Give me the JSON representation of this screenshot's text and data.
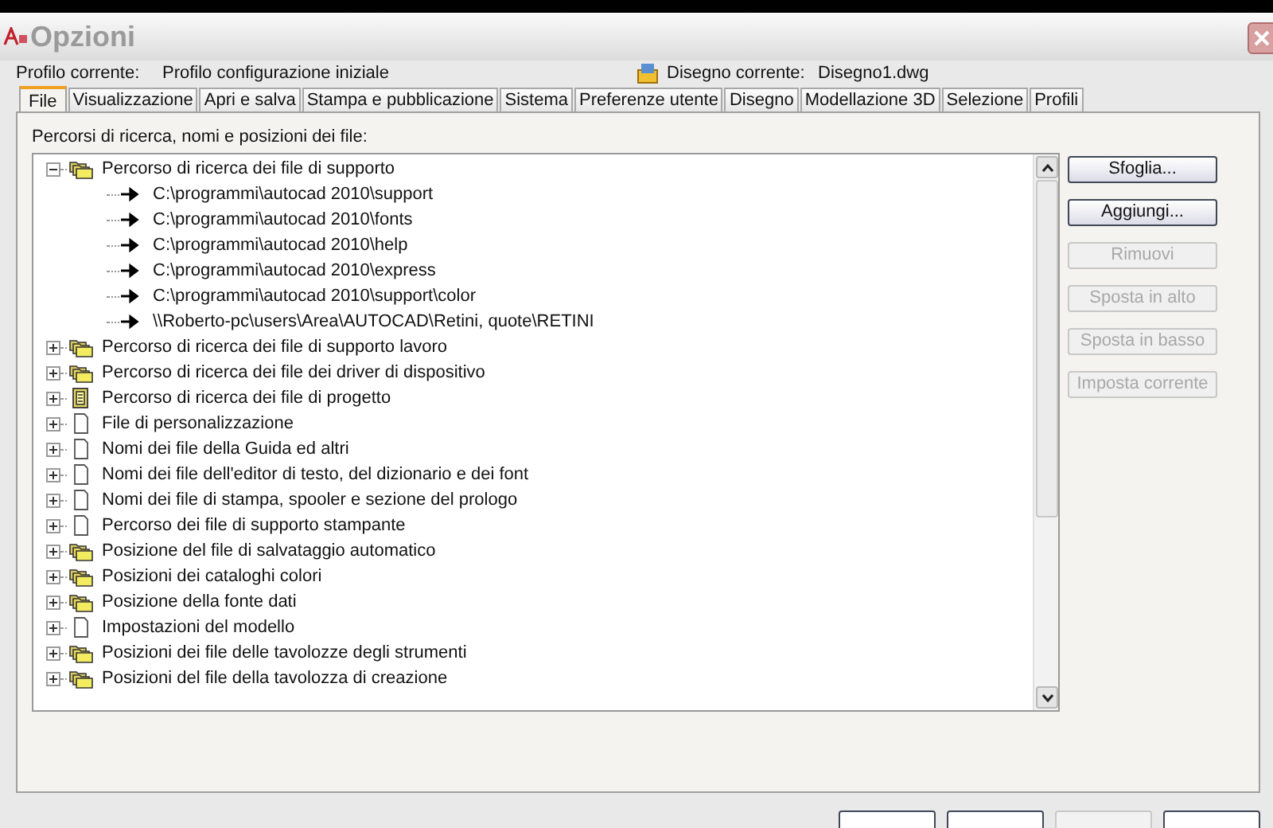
{
  "window": {
    "title": "Opzioni"
  },
  "profile": {
    "label": "Profilo corrente:",
    "value": "Profilo configurazione iniziale"
  },
  "drawing": {
    "label": "Disegno corrente:",
    "value": "Disegno1.dwg"
  },
  "tabs": [
    {
      "label": "File",
      "selected": true
    },
    {
      "label": "Visualizzazione",
      "selected": false
    },
    {
      "label": "Apri e salva",
      "selected": false
    },
    {
      "label": "Stampa e pubblicazione",
      "selected": false
    },
    {
      "label": "Sistema",
      "selected": false
    },
    {
      "label": "Preferenze utente",
      "selected": false
    },
    {
      "label": "Disegno",
      "selected": false
    },
    {
      "label": "Modellazione 3D",
      "selected": false
    },
    {
      "label": "Selezione",
      "selected": false
    },
    {
      "label": "Profili",
      "selected": false
    }
  ],
  "tree_label": "Percorsi di ricerca, nomi e posizioni dei file:",
  "tree": [
    {
      "label": "Percorso di ricerca dei file di supporto",
      "kind": "folders",
      "expanded": true,
      "children": [
        {
          "label": "C:\\programmi\\autocad 2010\\support",
          "kind": "path"
        },
        {
          "label": "C:\\programmi\\autocad 2010\\fonts",
          "kind": "path"
        },
        {
          "label": "C:\\programmi\\autocad 2010\\help",
          "kind": "path"
        },
        {
          "label": "C:\\programmi\\autocad 2010\\express",
          "kind": "path"
        },
        {
          "label": "C:\\programmi\\autocad 2010\\support\\color",
          "kind": "path"
        },
        {
          "label": "\\\\Roberto-pc\\users\\Area\\AUTOCAD\\Retini, quote\\RETINI",
          "kind": "path"
        }
      ]
    },
    {
      "label": "Percorso di ricerca dei file di supporto lavoro",
      "kind": "folders",
      "expanded": false
    },
    {
      "label": "Percorso di ricerca dei file dei driver di dispositivo",
      "kind": "folders",
      "expanded": false
    },
    {
      "label": "Percorso di ricerca dei file di progetto",
      "kind": "project",
      "expanded": false
    },
    {
      "label": "File di personalizzazione",
      "kind": "file",
      "expanded": false
    },
    {
      "label": "Nomi dei file della Guida ed altri",
      "kind": "file",
      "expanded": false
    },
    {
      "label": "Nomi dei file dell'editor di testo, del dizionario e dei font",
      "kind": "file",
      "expanded": false
    },
    {
      "label": "Nomi dei file di stampa, spooler e sezione del prologo",
      "kind": "file",
      "expanded": false
    },
    {
      "label": "Percorso dei file di supporto stampante",
      "kind": "file",
      "expanded": false
    },
    {
      "label": "Posizione del file di salvataggio automatico",
      "kind": "folders",
      "expanded": false
    },
    {
      "label": "Posizioni dei cataloghi colori",
      "kind": "folders",
      "expanded": false
    },
    {
      "label": "Posizione della fonte dati",
      "kind": "folders",
      "expanded": false
    },
    {
      "label": "Impostazioni del modello",
      "kind": "file",
      "expanded": false
    },
    {
      "label": "Posizioni dei file delle tavolozze degli strumenti",
      "kind": "folders",
      "expanded": false
    },
    {
      "label": "Posizioni del file della tavolozza di creazione",
      "kind": "folders",
      "expanded": false
    }
  ],
  "side_buttons": [
    {
      "label": "Sfoglia...",
      "disabled": false
    },
    {
      "label": "Aggiungi...",
      "disabled": false
    },
    {
      "label": "Rimuovi",
      "disabled": true
    },
    {
      "label": "Sposta in alto",
      "disabled": true
    },
    {
      "label": "Sposta in basso",
      "disabled": true
    },
    {
      "label": "Imposta corrente",
      "disabled": true
    }
  ],
  "bottom_buttons": [
    {
      "disabled": false
    },
    {
      "disabled": false
    },
    {
      "disabled": true
    },
    {
      "disabled": false
    }
  ]
}
